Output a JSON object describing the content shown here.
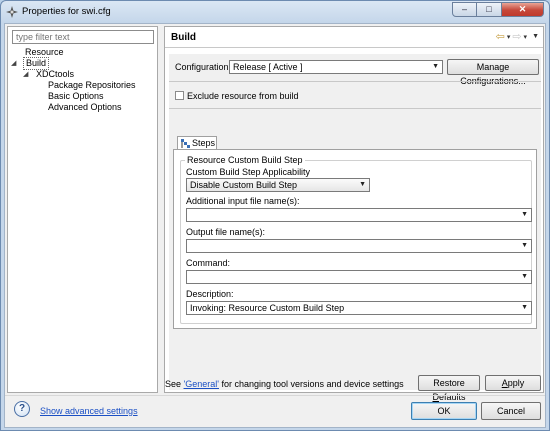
{
  "window": {
    "title": "Properties for swi.cfg",
    "minimize": "–",
    "maximize": "□",
    "close": "✕"
  },
  "filter": {
    "placeholder": "type filter text"
  },
  "tree": {
    "resource": "Resource",
    "build": "Build",
    "xdctools": "XDCtools",
    "package_repositories": "Package Repositories",
    "basic_options": "Basic Options",
    "advanced_options": "Advanced Options",
    "expanded_icon": "◢"
  },
  "page": {
    "title": "Build",
    "nav_back_icon": "⇦",
    "nav_forward_icon": "⇨",
    "nav_caret": "▾",
    "nav_menu": "▼"
  },
  "configuration": {
    "label": "Configuration:",
    "value": "Release  [ Active ]",
    "manage_button": "Manage Configurations..."
  },
  "exclude": {
    "label": "Exclude resource from build",
    "checked": false
  },
  "tabs": {
    "steps": "Steps"
  },
  "custom_build": {
    "group_title": "Resource Custom Build Step",
    "applicability_label": "Custom Build Step Applicability",
    "applicability_value": "Disable Custom Build Step",
    "additional_input_label": "Additional input file name(s):",
    "additional_input_value": "",
    "output_label": "Output file name(s):",
    "output_value": "",
    "command_label": "Command:",
    "command_value": "",
    "description_label": "Description:",
    "description_value": "Invoking: Resource Custom Build Step"
  },
  "footer_note": {
    "prefix": "See ",
    "link": "'General'",
    "suffix": " for changing tool versions and device settings"
  },
  "buttons": {
    "restore_defaults_pre": "Restore ",
    "restore_defaults_u": "D",
    "restore_defaults_post": "efaults",
    "apply_u": "A",
    "apply_post": "pply",
    "ok": "OK",
    "cancel": "Cancel"
  },
  "bottom": {
    "help_icon": "?",
    "show_advanced": "Show advanced settings"
  },
  "colors": {
    "link": "#1a4fc4",
    "title_bar": "#c4d6ea",
    "accent_nav": "#c8a24a"
  }
}
